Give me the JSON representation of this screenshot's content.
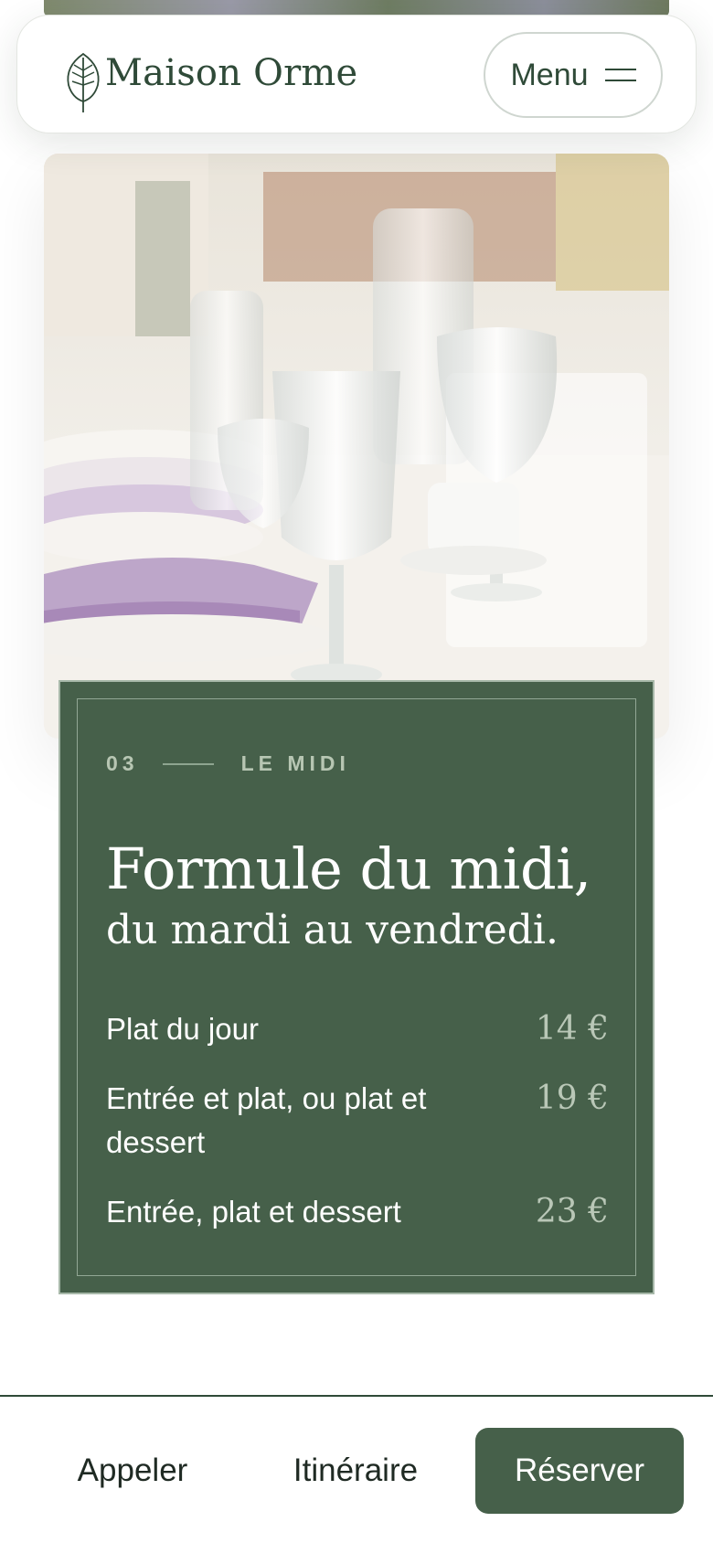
{
  "header": {
    "brand": "Maison Orme",
    "logo_icon": "leaf-icon",
    "menu_label": "Menu",
    "menu_icon": "hamburger-icon"
  },
  "hero": {
    "image_subject": "dining table with wine glasses and lilac napkins"
  },
  "lunch": {
    "number": "03",
    "label": "LE MIDI",
    "title": "Formule du midi,",
    "subtitle": "du mardi au vendredi.",
    "items": [
      {
        "name": "Plat du jour",
        "price": "14 €"
      },
      {
        "name": "Entrée et plat, ou plat et dessert",
        "price": "19 €"
      },
      {
        "name": "Entrée, plat et dessert",
        "price": "23 €"
      }
    ]
  },
  "actions": {
    "call": "Appeler",
    "directions": "Itinéraire",
    "book": "Réserver"
  },
  "colors": {
    "brand_green": "#46604a",
    "text_dark_green": "#2f4a38",
    "price_muted": "#b9c7b7"
  }
}
